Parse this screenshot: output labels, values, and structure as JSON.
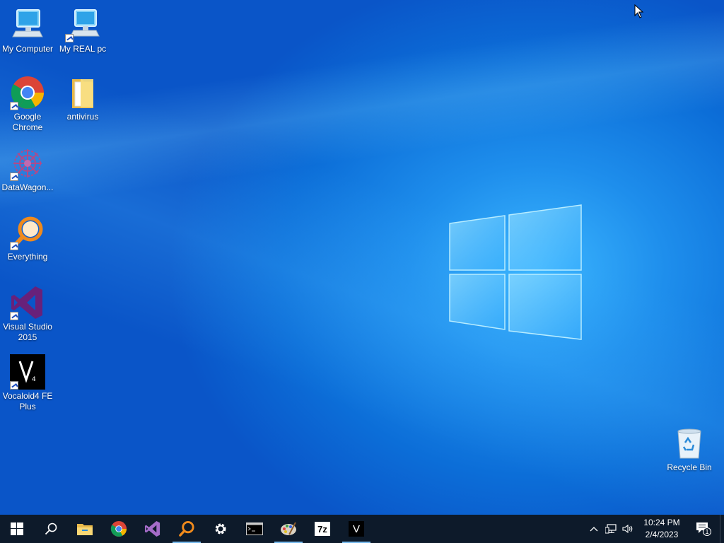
{
  "desktop": {
    "icons": [
      {
        "label": "My Computer",
        "icon": "monitor-icon"
      },
      {
        "label": "My REAL pc",
        "icon": "monitor-shortcut-icon"
      },
      {
        "label": "Google Chrome",
        "icon": "chrome-icon"
      },
      {
        "label": "antivirus",
        "icon": "folder-icon"
      },
      {
        "label": "DataWagon...",
        "icon": "datawagon-icon"
      },
      {
        "label": "Everything",
        "icon": "everything-search-icon"
      },
      {
        "label": "Visual Studio 2015",
        "icon": "visual-studio-icon"
      },
      {
        "label": "Vocaloid4 FE Plus",
        "icon": "vocaloid-icon"
      },
      {
        "label": "Recycle Bin",
        "icon": "recycle-bin-icon"
      }
    ]
  },
  "taskbar": {
    "pinned": [
      {
        "name": "start",
        "icon": "windows-start-icon"
      },
      {
        "name": "search",
        "icon": "search-icon"
      },
      {
        "name": "file-explorer",
        "icon": "folder-icon"
      },
      {
        "name": "chrome",
        "icon": "chrome-icon"
      },
      {
        "name": "visual-studio",
        "icon": "visual-studio-icon"
      },
      {
        "name": "everything",
        "icon": "everything-search-icon"
      },
      {
        "name": "settings",
        "icon": "gear-icon"
      },
      {
        "name": "command-prompt",
        "icon": "terminal-icon"
      },
      {
        "name": "paint",
        "icon": "palette-icon"
      },
      {
        "name": "7zip",
        "icon": "7zip-icon",
        "text": "7z"
      },
      {
        "name": "vocaloid",
        "icon": "vocaloid-icon",
        "text": "V"
      }
    ],
    "clock": {
      "time": "10:24 PM",
      "date": "2/4/2023"
    },
    "notification_count": "1"
  },
  "colors": {
    "taskbar": "#0d1a2a",
    "accent": "#76b9ed",
    "desktop_blue": "#0c6ed8"
  }
}
